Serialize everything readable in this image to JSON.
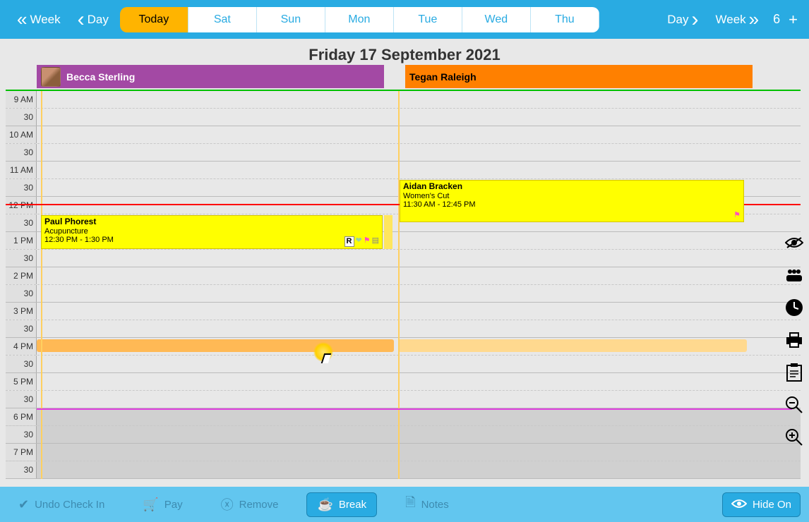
{
  "topbar": {
    "week_back": "Week",
    "day_back": "Day",
    "today": "Today",
    "tabs": [
      "Sat",
      "Sun",
      "Mon",
      "Tue",
      "Wed",
      "Thu"
    ],
    "day_fwd": "Day",
    "week_fwd": "Week",
    "count": "6"
  },
  "date_header": "Friday 17 September 2021",
  "staff": {
    "becca": "Becca Sterling",
    "tegan": "Tegan Raleigh"
  },
  "times": [
    "9 AM",
    "30",
    "10 AM",
    "30",
    "11 AM",
    "30",
    "12 PM",
    "30",
    "1 PM",
    "30",
    "2 PM",
    "30",
    "3 PM",
    "30",
    "4 PM",
    "30",
    "5 PM",
    "30",
    "6 PM",
    "30",
    "7 PM",
    "30"
  ],
  "appointments": {
    "paul": {
      "name": "Paul Phorest",
      "service": "Acupuncture",
      "time": "12:30 PM - 1:30 PM"
    },
    "aidan": {
      "name": "Aidan Bracken",
      "service": "Women's Cut",
      "time": "11:30 AM - 12:45 PM"
    }
  },
  "bottom": {
    "undo": "Undo Check In",
    "pay": "Pay",
    "remove": "Remove",
    "break": "Break",
    "notes": "Notes",
    "hide": "Hide On"
  }
}
